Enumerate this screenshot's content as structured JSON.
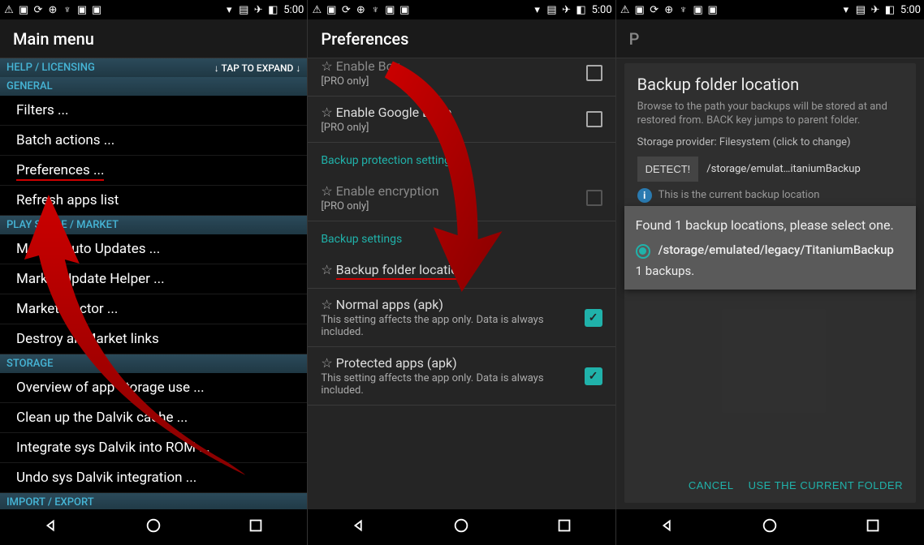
{
  "status": {
    "time": "5:00"
  },
  "screen1": {
    "title": "Main menu",
    "help_label": "HELP / LICENSING",
    "expand_label": "↓  TAP TO EXPAND  ↓",
    "sections": {
      "general": "GENERAL",
      "playstore": "PLAY STORE / MARKET",
      "storage": "STORAGE",
      "import": "IMPORT / EXPORT"
    },
    "items": {
      "filters": "Filters ...",
      "batch": "Batch actions ...",
      "preferences": "Preferences ...",
      "refresh": "Refresh apps list",
      "auto_updates": "Market Auto Updates ...",
      "update_helper": "Market Update Helper ...",
      "doctor": "Market Doctor ...",
      "destroy": "Destroy all Market links",
      "overview": "Overview of app storage use ...",
      "cleanup": "Clean up the Dalvik cache ...",
      "integrate": "Integrate sys Dalvik into ROM ...",
      "undo": "Undo sys Dalvik integration ..."
    }
  },
  "screen2": {
    "title": "Preferences",
    "pro_only": "[PRO only]",
    "items": {
      "enable_box": "Enable Box",
      "enable_gdrive": "Enable Google Drive",
      "enable_encryption": "Enable encryption",
      "backup_folder": "Backup folder location",
      "normal_apps": "Normal apps (apk)",
      "protected_apps": "Protected apps (apk)",
      "affects": "This setting affects the app only. Data is always included."
    },
    "cats": {
      "protection": "Backup protection settings",
      "backup": "Backup settings"
    }
  },
  "screen3": {
    "title_letter": "P",
    "dialog": {
      "title": "Backup folder location",
      "desc": "Browse to the path your backups will be stored at and restored from. BACK key jumps to parent folder.",
      "provider": "Storage provider: Filesystem (click to change)",
      "detect": "DETECT!",
      "path": "/storage/emulat…itaniumBackup",
      "info": "This is the current backup location",
      "popup_msg": "Found 1 backup locations, please select one.",
      "radio_path": "/storage/emulated/legacy/TitaniumBackup",
      "backup_count": "1 backups.",
      "cancel": "CANCEL",
      "use": "USE THE CURRENT FOLDER"
    }
  }
}
